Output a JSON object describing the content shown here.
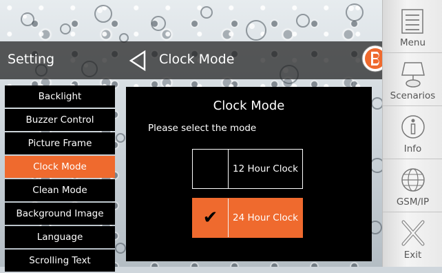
{
  "header": {
    "section": "Setting",
    "title": "Clock Mode"
  },
  "menu": {
    "items": [
      {
        "label": "Backlight"
      },
      {
        "label": "Buzzer Control"
      },
      {
        "label": "Picture Frame"
      },
      {
        "label": "Clock Mode",
        "active": true
      },
      {
        "label": "Clean Mode"
      },
      {
        "label": "Background Image"
      },
      {
        "label": "Language"
      },
      {
        "label": "Scrolling Text"
      }
    ]
  },
  "dialog": {
    "title": "Clock Mode",
    "prompt": "Please select the mode",
    "options": [
      {
        "label": "12 Hour Clock",
        "selected": false
      },
      {
        "label": "24 Hour Clock",
        "selected": true
      }
    ],
    "check_glyph": "✔"
  },
  "toolbar": {
    "items": [
      {
        "label": "Menu",
        "icon": "menu-list-icon"
      },
      {
        "label": "Scenarios",
        "icon": "scenarios-lamp-icon"
      },
      {
        "label": "Info",
        "icon": "info-icon"
      },
      {
        "label": "GSM/IP",
        "icon": "globe-icon"
      },
      {
        "label": "Exit",
        "icon": "exit-x-icon"
      }
    ]
  },
  "colors": {
    "accent": "#ef6a2e",
    "panel": "#000000",
    "header_overlay": "#1e1e1e"
  }
}
